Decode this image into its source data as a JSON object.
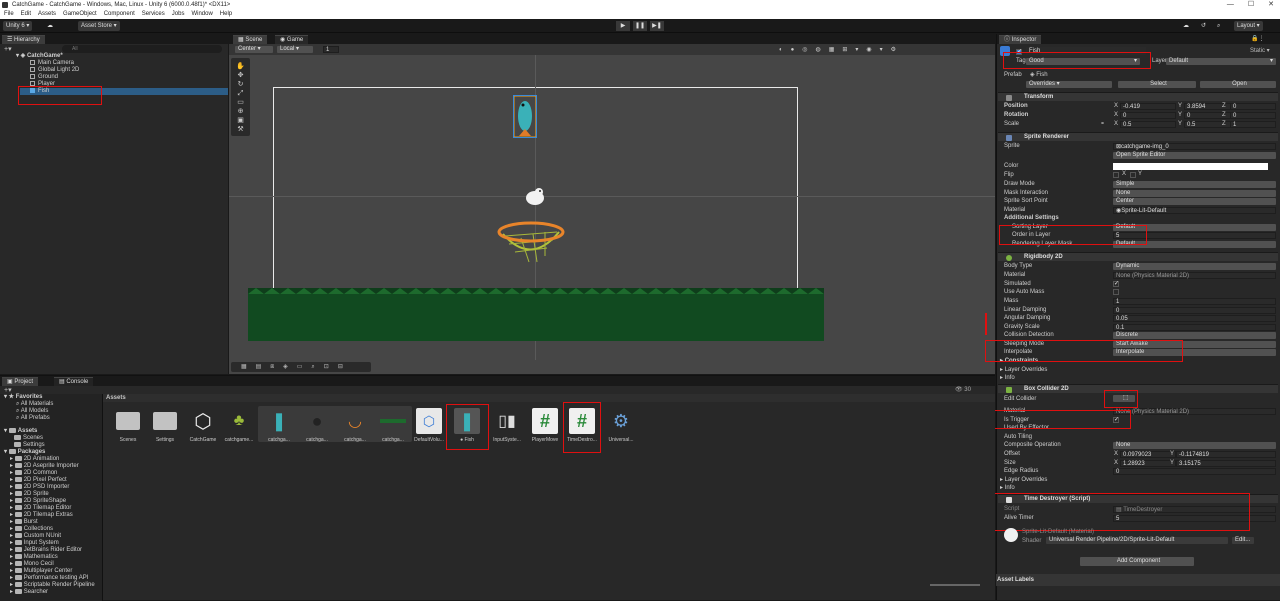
{
  "window": {
    "title": "CatchGame - CatchGame - Windows, Mac, Linux - Unity 6 (6000.0.48f1)* <DX11>",
    "min": "—",
    "max": "☐",
    "close": "✕"
  },
  "menu": [
    "File",
    "Edit",
    "Assets",
    "GameObject",
    "Component",
    "Services",
    "Jobs",
    "Window",
    "Help"
  ],
  "toolbar": {
    "unity_label": "Unity 6",
    "store_label": "Asset Store",
    "layout_label": "Layout"
  },
  "hierarchy": {
    "tab": "Hierarchy",
    "search_placeholder": "All",
    "scene": "CatchGame*",
    "items": [
      "Main Camera",
      "Global Light 2D",
      "Ground",
      "Player",
      "Fish"
    ]
  },
  "scene_tabs": {
    "scene": "Scene",
    "game": "Game"
  },
  "scene_toolbar": {
    "pivot": "Center",
    "space": "Local",
    "snap": "1"
  },
  "inspector": {
    "tab": "Inspector",
    "object_name": "Fish",
    "static_label": "Static",
    "tag_label": "Tag",
    "tag_value": "Good",
    "layer_label": "Layer",
    "layer_value": "Default",
    "prefab_label": "Prefab",
    "prefab_value": "Fish",
    "overrides": "Overrides",
    "select": "Select",
    "open": "Open",
    "transform": {
      "title": "Transform",
      "position": "Position",
      "rotation": "Rotation",
      "scale": "Scale",
      "px": "-0.419",
      "py": "3.8594",
      "pz": "0",
      "rx": "0",
      "ry": "0",
      "rz": "0",
      "sx": "0.5",
      "sy": "0.5",
      "sz": "1"
    },
    "sprite_renderer": {
      "title": "Sprite Renderer",
      "sprite_label": "Sprite",
      "sprite_value": "catchgame-img_0",
      "open_editor": "Open Sprite Editor",
      "color": "Color",
      "flip": "Flip",
      "flip_x": "X",
      "flip_y": "Y",
      "draw_mode": "Draw Mode",
      "draw_mode_value": "Simple",
      "mask": "Mask Interaction",
      "mask_value": "None",
      "sort_point": "Sprite Sort Point",
      "sort_point_value": "Center",
      "material": "Material",
      "material_value": "Sprite-Lit-Default",
      "additional": "Additional Settings",
      "sorting_layer": "Sorting Layer",
      "sorting_layer_value": "Default",
      "order": "Order in Layer",
      "order_value": "5",
      "rendering_mask": "Rendering Layer Mask",
      "rendering_mask_value": "Default"
    },
    "rigidbody": {
      "title": "Rigidbody 2D",
      "body_type": "Body Type",
      "body_type_value": "Dynamic",
      "material": "Material",
      "material_value": "None (Physics Material 2D)",
      "simulated": "Simulated",
      "auto_mass": "Use Auto Mass",
      "mass": "Mass",
      "mass_value": "1",
      "linear": "Linear Damping",
      "linear_value": "0",
      "angular": "Angular Damping",
      "angular_value": "0.05",
      "gravity": "Gravity Scale",
      "gravity_value": "0.1",
      "collision": "Collision Detection",
      "collision_value": "Discrete",
      "sleeping": "Sleeping Mode",
      "sleeping_value": "Start Awake",
      "interpolate": "Interpolate",
      "interpolate_value": "Interpolate",
      "constraints": "Constraints",
      "layer_overrides": "Layer Overrides",
      "info": "Info"
    },
    "box_collider": {
      "title": "Box Collider 2D",
      "edit": "Edit Collider",
      "material": "Material",
      "material_value": "None (Physics Material 2D)",
      "trigger": "Is Trigger",
      "effector": "Used By Effector",
      "tiling": "Auto Tiling",
      "composite": "Composite Operation",
      "composite_value": "None",
      "offset": "Offset",
      "ox": "0.0979023",
      "oy": "-0.1174819",
      "size": "Size",
      "sx": "1.28923",
      "sy": "3.15175",
      "edge": "Edge Radius",
      "edge_value": "0",
      "layer_overrides": "Layer Overrides",
      "info": "Info"
    },
    "time_destroyer": {
      "title": "Time Destroyer (Script)",
      "script": "Script",
      "script_value": "TimeDestroyer",
      "alive": "Alive Timer",
      "alive_value": "5"
    },
    "material_block": {
      "name": "Sprite-Lit-Default (Material)",
      "shader": "Shader",
      "shader_value": "Universal Render Pipeline/2D/Sprite-Lit-Default",
      "edit": "Edit..."
    },
    "add_component": "Add Component",
    "asset_labels": "Asset Labels"
  },
  "project": {
    "tab": "Project",
    "console": "Console",
    "assets_header": "Assets",
    "count": "30",
    "favorites": "Favorites",
    "fav_items": [
      "All Materials",
      "All Models",
      "All Prefabs"
    ],
    "assets_root": "Assets",
    "asset_folders": [
      "Scenes",
      "Settings"
    ],
    "packages": "Packages",
    "package_items": [
      "2D Animation",
      "2D Aseprite Importer",
      "2D Common",
      "2D Pixel Perfect",
      "2D PSD Importer",
      "2D Sprite",
      "2D SpriteShape",
      "2D Tilemap Editor",
      "2D Tilemap Extras",
      "Burst",
      "Collections",
      "Custom NUnit",
      "Input System",
      "JetBrains Rider Editor",
      "Mathematics",
      "Mono Cecil",
      "Multiplayer Center",
      "Performance testing API",
      "Scriptable Render Pipeline",
      "Searcher"
    ],
    "asset_items": [
      "Scenes",
      "Settings",
      "CatchGame",
      "catchgame...",
      "catchga...",
      "catchga...",
      "catchga...",
      "catchga...",
      "DefaultVolu...",
      "Fish",
      "InputSyste...",
      "PlayerMove",
      "TimeDestro...",
      "Universal..."
    ]
  }
}
